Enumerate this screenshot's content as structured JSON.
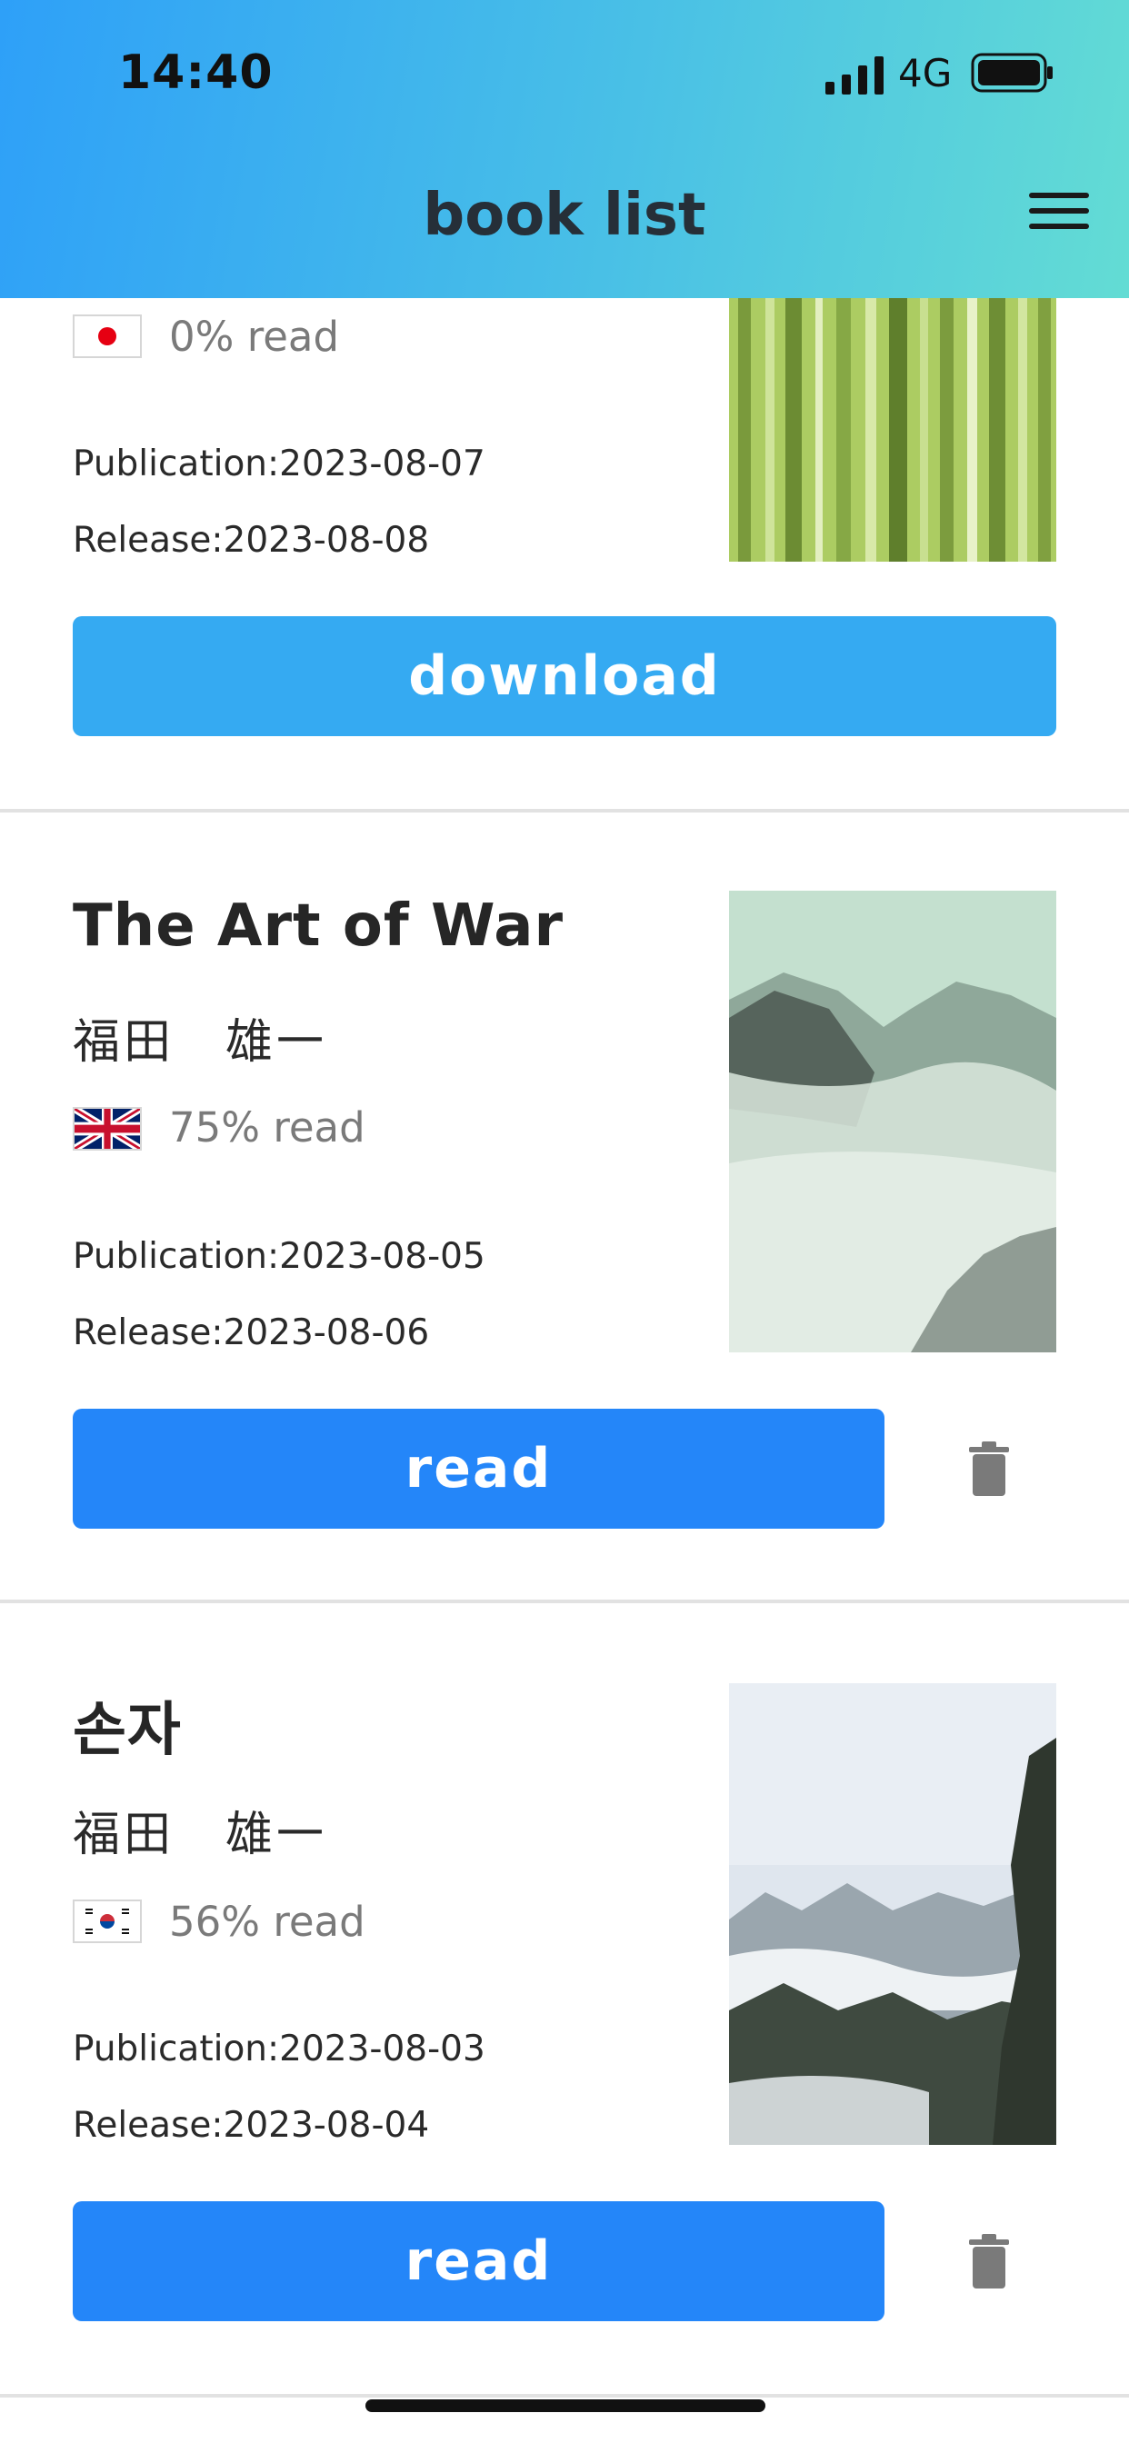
{
  "status_bar": {
    "time": "14:40",
    "network": "4G"
  },
  "header": {
    "title": "book list"
  },
  "books": [
    {
      "title": "",
      "author": "",
      "language": "Japanese",
      "progress": "0% read",
      "publication": "Publication:2023-08-07",
      "release": "Release:2023-08-08",
      "action": "download",
      "cover": "bamboo forest"
    },
    {
      "title": "The Art of War",
      "author": "福田　雄一",
      "language": "English (UK)",
      "progress": "75% read",
      "publication": "Publication:2023-08-05",
      "release": "Release:2023-08-06",
      "action": "read",
      "cover": "misty mountains green"
    },
    {
      "title": "손자",
      "author": "福田　雄一",
      "language": "Korean",
      "progress": "56% read",
      "publication": "Publication:2023-08-03",
      "release": "Release:2023-08-04",
      "action": "read",
      "cover": "cloudy mountain cliffs"
    }
  ],
  "icons": {
    "menu": "hamburger-icon",
    "delete": "trash-icon"
  },
  "colors": {
    "download": "#35aaf2",
    "read": "#2486f9",
    "header_start": "#2ea0f8",
    "header_end": "#63dcd4"
  }
}
